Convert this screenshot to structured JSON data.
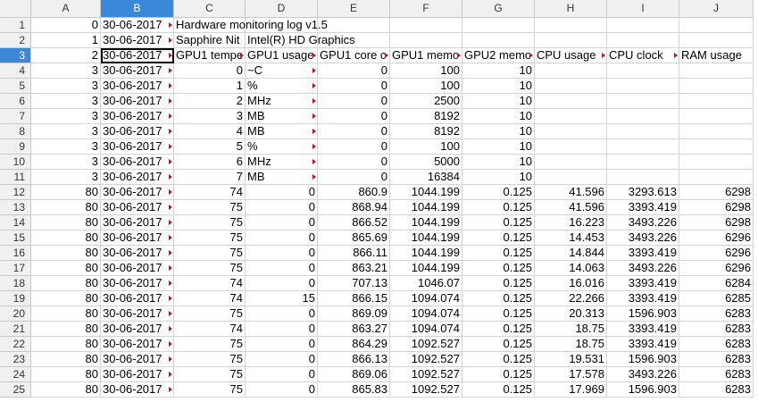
{
  "columns": [
    "A",
    "B",
    "C",
    "D",
    "E",
    "F",
    "G",
    "H",
    "I",
    "J"
  ],
  "active_column": "B",
  "active_row": 3,
  "rows": [
    {
      "n": "1",
      "c": [
        "0",
        "30-06-2017",
        "Hardware monitoring log v1.5",
        "",
        "",
        "",
        "",
        "",
        "",
        ""
      ]
    },
    {
      "n": "2",
      "c": [
        "1",
        "30-06-2017",
        "Sapphire Nit",
        "Intel(R) HD Graphics",
        "",
        "",
        "",
        "",
        "",
        ""
      ]
    },
    {
      "n": "3",
      "c": [
        "2",
        "30-06-2017",
        "GPU1 tempe",
        "GPU1 usage",
        "GPU1 core c",
        "GPU1 memo",
        "GPU2 memo",
        "CPU usage",
        "CPU clock",
        "RAM usage"
      ]
    },
    {
      "n": "4",
      "c": [
        "3",
        "30-06-2017",
        "0",
        "~C",
        "0",
        "100",
        "10",
        "",
        "",
        ""
      ]
    },
    {
      "n": "5",
      "c": [
        "3",
        "30-06-2017",
        "1",
        "%",
        "0",
        "100",
        "10",
        "",
        "",
        ""
      ]
    },
    {
      "n": "6",
      "c": [
        "3",
        "30-06-2017",
        "2",
        "MHz",
        "0",
        "2500",
        "10",
        "",
        "",
        ""
      ]
    },
    {
      "n": "7",
      "c": [
        "3",
        "30-06-2017",
        "3",
        "MB",
        "0",
        "8192",
        "10",
        "",
        "",
        ""
      ]
    },
    {
      "n": "8",
      "c": [
        "3",
        "30-06-2017",
        "4",
        "MB",
        "0",
        "8192",
        "10",
        "",
        "",
        ""
      ]
    },
    {
      "n": "9",
      "c": [
        "3",
        "30-06-2017",
        "5",
        "%",
        "0",
        "100",
        "10",
        "",
        "",
        ""
      ]
    },
    {
      "n": "10",
      "c": [
        "3",
        "30-06-2017",
        "6",
        "MHz",
        "0",
        "5000",
        "10",
        "",
        "",
        ""
      ]
    },
    {
      "n": "11",
      "c": [
        "3",
        "30-06-2017",
        "7",
        "MB",
        "0",
        "16384",
        "10",
        "",
        "",
        ""
      ]
    },
    {
      "n": "12",
      "c": [
        "80",
        "30-06-2017",
        "74",
        "0",
        "860.9",
        "1044.199",
        "0.125",
        "41.596",
        "3293.613",
        "6298"
      ]
    },
    {
      "n": "13",
      "c": [
        "80",
        "30-06-2017",
        "75",
        "0",
        "868.94",
        "1044.199",
        "0.125",
        "41.596",
        "3393.419",
        "6298"
      ]
    },
    {
      "n": "14",
      "c": [
        "80",
        "30-06-2017",
        "75",
        "0",
        "866.52",
        "1044.199",
        "0.125",
        "16.223",
        "3493.226",
        "6298"
      ]
    },
    {
      "n": "15",
      "c": [
        "80",
        "30-06-2017",
        "75",
        "0",
        "865.69",
        "1044.199",
        "0.125",
        "14.453",
        "3493.226",
        "6296"
      ]
    },
    {
      "n": "16",
      "c": [
        "80",
        "30-06-2017",
        "75",
        "0",
        "866.11",
        "1044.199",
        "0.125",
        "14.844",
        "3393.419",
        "6296"
      ]
    },
    {
      "n": "17",
      "c": [
        "80",
        "30-06-2017",
        "75",
        "0",
        "863.21",
        "1044.199",
        "0.125",
        "14.063",
        "3493.226",
        "6296"
      ]
    },
    {
      "n": "18",
      "c": [
        "80",
        "30-06-2017",
        "74",
        "0",
        "707.13",
        "1046.07",
        "0.125",
        "16.016",
        "3393.419",
        "6284"
      ]
    },
    {
      "n": "19",
      "c": [
        "80",
        "30-06-2017",
        "74",
        "15",
        "866.15",
        "1094.074",
        "0.125",
        "22.266",
        "3393.419",
        "6285"
      ]
    },
    {
      "n": "20",
      "c": [
        "80",
        "30-06-2017",
        "75",
        "0",
        "869.09",
        "1094.074",
        "0.125",
        "20.313",
        "1596.903",
        "6283"
      ]
    },
    {
      "n": "21",
      "c": [
        "80",
        "30-06-2017",
        "74",
        "0",
        "863.27",
        "1094.074",
        "0.125",
        "18.75",
        "3393.419",
        "6283"
      ]
    },
    {
      "n": "22",
      "c": [
        "80",
        "30-06-2017",
        "75",
        "0",
        "864.29",
        "1092.527",
        "0.125",
        "18.75",
        "3393.419",
        "6283"
      ]
    },
    {
      "n": "23",
      "c": [
        "80",
        "30-06-2017",
        "75",
        "0",
        "866.13",
        "1092.527",
        "0.125",
        "19.531",
        "1596.903",
        "6283"
      ]
    },
    {
      "n": "24",
      "c": [
        "80",
        "30-06-2017",
        "75",
        "0",
        "869.06",
        "1092.527",
        "0.125",
        "17.578",
        "3493.226",
        "6283"
      ]
    },
    {
      "n": "25",
      "c": [
        "80",
        "30-06-2017",
        "75",
        "0",
        "865.83",
        "1092.527",
        "0.125",
        "17.969",
        "1596.903",
        "6283"
      ]
    }
  ]
}
